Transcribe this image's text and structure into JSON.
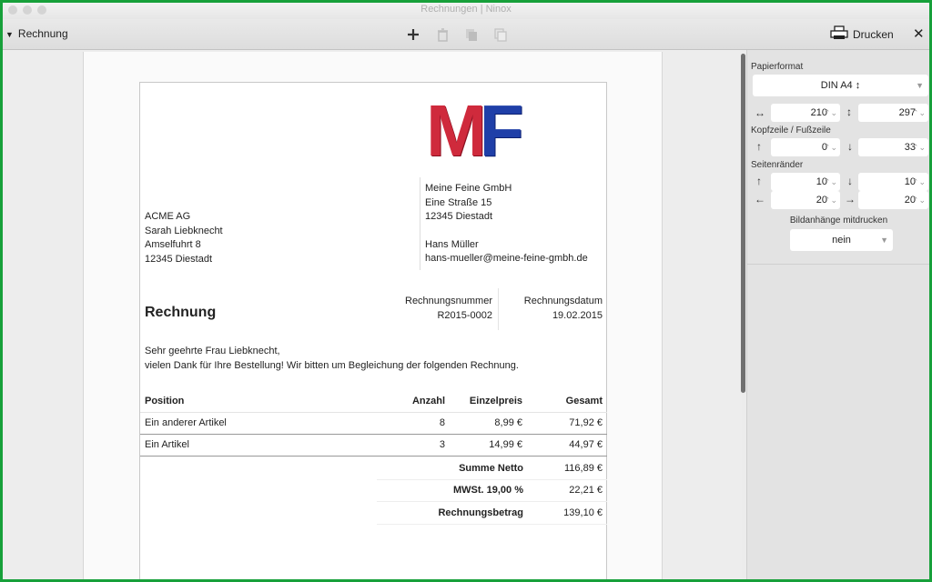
{
  "window": {
    "title": "Rechnungen | Ninox"
  },
  "toolbar": {
    "view_label": "Rechnung",
    "add_icon": "plus-icon",
    "delete_icon": "trash-icon",
    "copy_icon": "copy-icon",
    "paste_icon": "duplicate-icon",
    "print_label": "Drucken",
    "close_label": "✕"
  },
  "invoice": {
    "logo": {
      "m": "M",
      "f": "F"
    },
    "recipient": [
      "ACME AG",
      "Sarah Liebknecht",
      "Amselfuhrt 8",
      "12345 Diestadt"
    ],
    "sender": {
      "company": "Meine Feine GmbH",
      "street": "Eine Straße 15",
      "city": "12345 Diestadt",
      "contact": "Hans Müller",
      "email": "hans-mueller@meine-feine-gmbh.de"
    },
    "title": "Rechnung",
    "number_label": "Rechnungsnummer",
    "number": "R2015-0002",
    "date_label": "Rechnungsdatum",
    "date": "19.02.2015",
    "greeting": "Sehr geehrte Frau Liebknecht,",
    "message": "vielen Dank für Ihre Bestellung! Wir bitten um Begleichung der folgenden Rechnung.",
    "table": {
      "headers": [
        "Position",
        "Anzahl",
        "Einzelpreis",
        "Gesamt"
      ],
      "rows": [
        [
          "Ein anderer Artikel",
          "8",
          "8,99 €",
          "71,92 €"
        ],
        [
          "Ein Artikel",
          "3",
          "14,99 €",
          "44,97 €"
        ]
      ]
    },
    "totals": [
      {
        "label": "Summe Netto",
        "value": "116,89 €"
      },
      {
        "label": "MWSt. 19,00 %",
        "value": "22,21 €"
      },
      {
        "label": "Rechnungsbetrag",
        "value": "139,10 €"
      }
    ]
  },
  "panel": {
    "paper_label": "Papierformat",
    "paper_value": "DIN A4 ↕",
    "width": "210",
    "height": "297",
    "header_footer_label": "Kopfzeile / Fußzeile",
    "header": "0",
    "footer": "33",
    "margins_label": "Seitenränder",
    "margin_top": "10",
    "margin_bottom": "10",
    "margin_left": "20",
    "margin_right": "20",
    "attachments_label": "Bildanhänge mitdrucken",
    "attachments_value": "nein"
  }
}
